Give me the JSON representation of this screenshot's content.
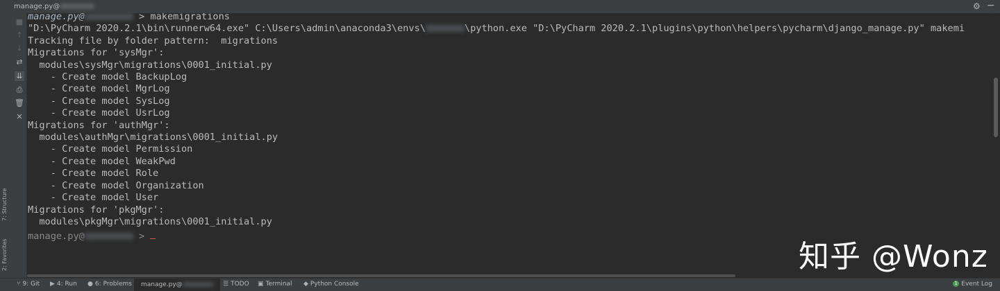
{
  "window": {
    "title_prefix": "manage.py@",
    "title_blurred": "",
    "gear_icon": "⚙",
    "hide_icon": "−"
  },
  "side_tabs": {
    "structure": "7: Structure",
    "favorites": "2: Favorites"
  },
  "toolbar_icons": {
    "stop": "■",
    "up": "↑",
    "down": "↓",
    "wrap": "⇄",
    "scroll_end": "⇊",
    "print": "⎙",
    "trash": "🗑",
    "close": "✕"
  },
  "console": {
    "prompt_prefix": "manage.py@",
    "prompt_suffix": " > makemigrations",
    "lines": [
      "\"D:\\PyCharm 2020.2.1\\bin\\runnerw64.exe\" C:\\Users\\admin\\anaconda3\\envs\\",
      "\\python.exe \"D:\\PyCharm 2020.2.1\\plugins\\python\\helpers\\pycharm\\django_manage.py\" makemi",
      "Tracking file by folder pattern:  migrations",
      "Migrations for 'sysMgr':",
      "  modules\\sysMgr\\migrations\\0001_initial.py",
      "    - Create model BackupLog",
      "    - Create model MgrLog",
      "    - Create model SysLog",
      "    - Create model UsrLog",
      "Migrations for 'authMgr':",
      "  modules\\authMgr\\migrations\\0001_initial.py",
      "    - Create model Permission",
      "    - Create model WeakPwd",
      "    - Create model Role",
      "    - Create model Organization",
      "    - Create model User",
      "Migrations for 'pkgMgr':",
      "  modules\\pkgMgr\\migrations\\0001_initial.py"
    ],
    "final_prompt_prefix": "manage.py@",
    "final_prompt_suffix": " > "
  },
  "watermark": "知乎 @Wonz",
  "bottom_tabs": [
    {
      "icon": "⑂",
      "label": "9: Git"
    },
    {
      "icon": "▶",
      "label": "4: Run"
    },
    {
      "icon": "●",
      "label": "6: Problems"
    },
    {
      "icon": "",
      "label": "manage.py@"
    },
    {
      "icon": "☰",
      "label": "TODO"
    },
    {
      "icon": "▣",
      "label": "Terminal"
    },
    {
      "icon": "◆",
      "label": "Python Console"
    }
  ],
  "event_log": {
    "badge": "1",
    "label": "Event Log"
  },
  "colors": {
    "background": "#2b2b2b",
    "panel": "#3c3f41",
    "text": "#bbbbbb",
    "event_badge": "#499c54"
  }
}
